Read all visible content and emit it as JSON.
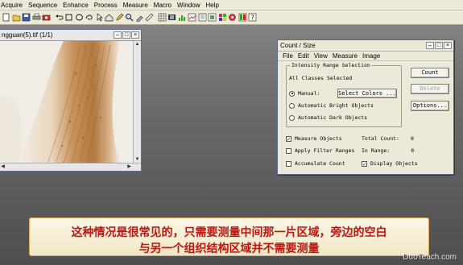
{
  "menubar": {
    "items": [
      "Acquire",
      "Sequence",
      "Enhance",
      "Process",
      "Measure",
      "Macro",
      "Window",
      "Help"
    ]
  },
  "toolbar": {
    "icons": [
      "new-icon",
      "open-icon",
      "save-icon",
      "print-icon",
      "camera-icon",
      "undo-icon",
      "rect-select-icon",
      "ellipse-select-icon",
      "freehand-select-icon",
      "pointer-icon",
      "home-icon",
      "edit-icon",
      "zoom-icon",
      "eyedropper-icon",
      "measure-icon",
      "grid-icon",
      "film-icon",
      "histogram-icon",
      "chart-icon",
      "filter-icon",
      "layers-icon",
      "tile-icon",
      "count-icon",
      "color-icon",
      "help-icon"
    ]
  },
  "image_window": {
    "title": "ngguan(5).tif (1/1)"
  },
  "dialog": {
    "title": "Count / Size",
    "menu": [
      "File",
      "Edit",
      "View",
      "Measure",
      "Image"
    ],
    "group_label": "Intensity Range Selection",
    "all_classes": "All Classes Selected",
    "manual": "Manual:",
    "select_colors": "Select Colors ...",
    "auto_bright": "Automatic Bright Objects",
    "auto_dark": "Automatic Dark Objects",
    "measure_objects": "Measure Objects",
    "apply_filter": "Apply Filter Ranges",
    "accumulate": "Accumulate Count",
    "total_count_label": "Total Count:",
    "total_count_value": "0",
    "in_range_label": "In Range:",
    "in_range_value": "0",
    "display_objects": "Display Objects",
    "count_button": "Count",
    "delete_button": "Delete",
    "options_button": "Options..."
  },
  "subtitle": {
    "line1": "这种情况是很常见的，只需要测量中间那一片区域，旁边的空白",
    "line2": "与另一个组织结构区域并不需要测量"
  },
  "watermark": "DuoTeach.com"
}
